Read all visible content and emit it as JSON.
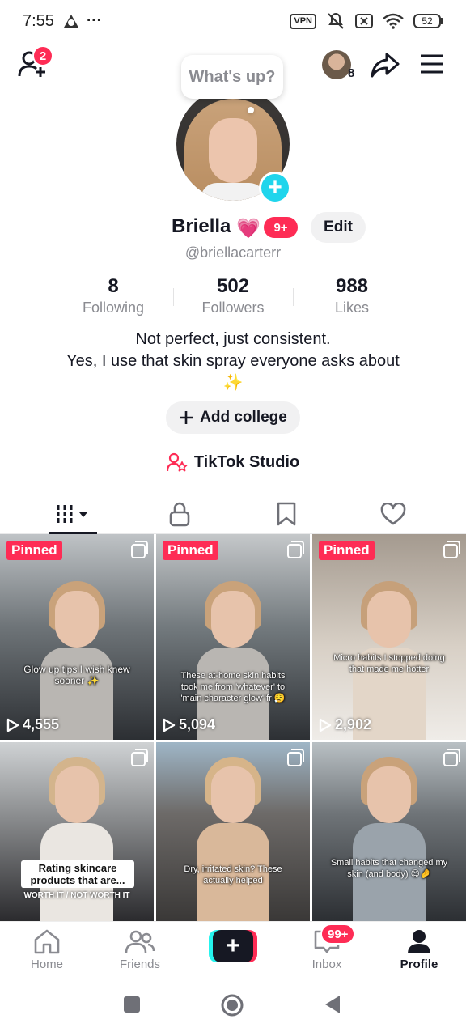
{
  "status_bar": {
    "time": "7:55",
    "more": "···",
    "vpn": "VPN",
    "battery": "52"
  },
  "top_bar": {
    "friend_requests_count": "2",
    "accounts_count": "8"
  },
  "profile": {
    "whats_up": "What's up?",
    "name": "Briella",
    "heart": "💗",
    "notifications": "9+",
    "edit_label": "Edit",
    "username": "@briellacarterr",
    "stats": [
      {
        "value": "8",
        "label": "Following"
      },
      {
        "value": "502",
        "label": "Followers"
      },
      {
        "value": "988",
        "label": "Likes"
      }
    ],
    "bio_line1": "Not perfect, just consistent.",
    "bio_line2": "Yes, I use that skin spray everyone asks about",
    "bio_line3": "✨",
    "add_college": "Add college",
    "studio": "TikTok Studio"
  },
  "tabs": [
    "videos-grid",
    "private",
    "saved",
    "liked"
  ],
  "videos": [
    {
      "pinned": "Pinned",
      "caption": "Glow up tips I wish knew sooner ✨",
      "views": "4,555"
    },
    {
      "pinned": "Pinned",
      "caption": "These at-home skin habits took me from 'whatever' to 'main character glow' fr 😮‍💨",
      "views": "5,094"
    },
    {
      "pinned": "Pinned",
      "caption": "Micro habits I stopped doing that made me hotter",
      "views": "2,902"
    },
    {
      "caption": "Rating skincare products that are...",
      "caption_sub": "WORTH IT / NOT WORTH IT"
    },
    {
      "caption": "Dry, irritated skin? These actually helped"
    },
    {
      "caption": "Small habits that changed my skin (and body) 😋🤌"
    }
  ],
  "bottom_nav": {
    "home": "Home",
    "friends": "Friends",
    "create": "+",
    "inbox": "Inbox",
    "inbox_badge": "99+",
    "profile": "Profile"
  },
  "colors": {
    "accent_red": "#fe2c55",
    "accent_cyan": "#25f4ee",
    "text_primary": "#161823",
    "text_secondary": "#8a8b91"
  }
}
